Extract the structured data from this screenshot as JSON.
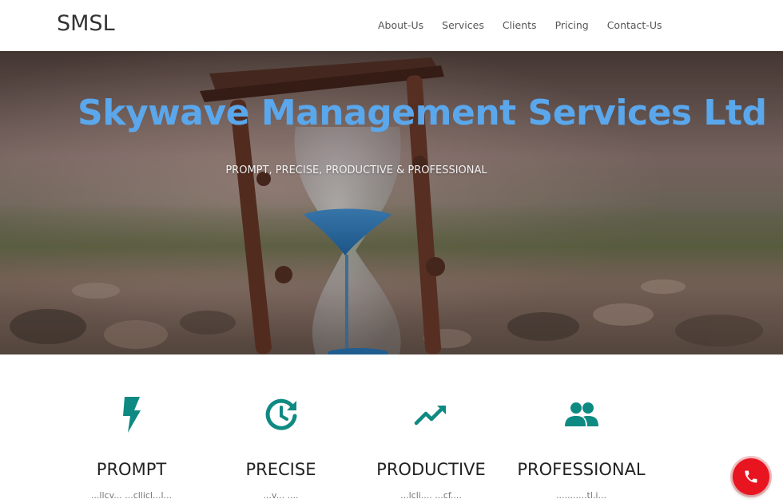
{
  "nav": {
    "brand": "SMSL",
    "links": [
      "About-Us",
      "Services",
      "Clients",
      "Pricing",
      "Contact-Us"
    ]
  },
  "hero": {
    "title": "Skywave Management Services Ltd",
    "subtitle": "PROMPT, PRECISE, PRODUCTIVE & PROFESSIONAL"
  },
  "features": [
    {
      "icon": "lightning-bolt-icon",
      "title": "PROMPT",
      "text": "...llcv... ...cllicl...l..."
    },
    {
      "icon": "clock-refresh-icon",
      "title": "PRECISE",
      "text": "...v... ...."
    },
    {
      "icon": "trending-up-icon",
      "title": "PRODUCTIVE",
      "text": "...lcli.... ...cf...."
    },
    {
      "icon": "people-icon",
      "title": "PROFESSIONAL",
      "text": "...........tl.i..."
    }
  ],
  "call_button": {
    "icon": "phone-icon"
  },
  "colors": {
    "accent": "#0e8a82",
    "hero_title": "#5aa7ec",
    "call_button": "#e8141f"
  }
}
